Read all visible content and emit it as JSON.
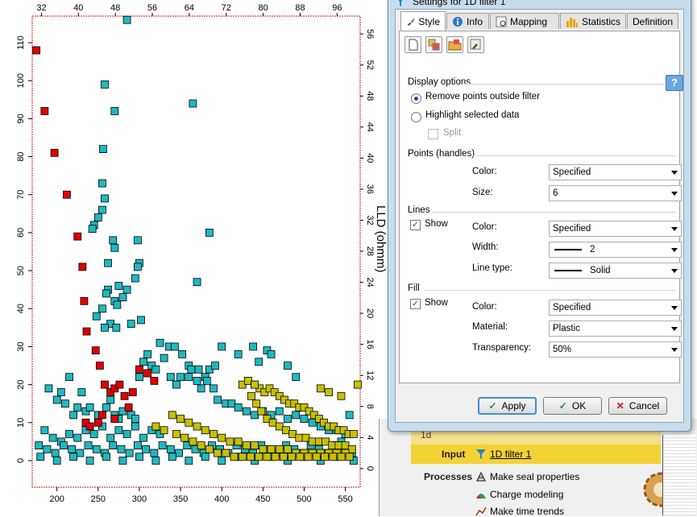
{
  "chart_data": {
    "type": "scatter",
    "title": "",
    "x_axis_bottom": {
      "ticks": [
        "200",
        "250",
        "300",
        "350",
        "400",
        "450",
        "500",
        "550"
      ],
      "range": [
        170,
        568
      ]
    },
    "x_axis_top": {
      "ticks": [
        "32",
        "40",
        "48",
        "56",
        "64",
        "72",
        "80",
        "88",
        "96"
      ],
      "range": [
        30,
        101
      ]
    },
    "y_axis_left": {
      "ticks": [
        "0",
        "10",
        "20",
        "30",
        "40",
        "50",
        "60",
        "70",
        "80",
        "90",
        "100",
        "110"
      ],
      "range": [
        -7,
        117
      ]
    },
    "y_axis_right": {
      "ticks": [
        "0",
        "4",
        "8",
        "12",
        "16",
        "20",
        "24",
        "28",
        "32",
        "36",
        "40",
        "44",
        "48",
        "52",
        "56"
      ],
      "range": [
        -2.4,
        58.3
      ],
      "title": "LLD (ohmm)"
    },
    "grid": false,
    "series": [
      {
        "color": "#e00000",
        "points": [
          [
            175,
            108
          ],
          [
            185,
            92
          ],
          [
            197,
            81
          ],
          [
            212,
            70
          ],
          [
            225,
            59
          ],
          [
            231,
            51
          ],
          [
            233,
            42
          ],
          [
            236,
            34
          ],
          [
            247,
            29
          ],
          [
            252,
            25
          ],
          [
            258,
            20
          ],
          [
            265,
            18
          ],
          [
            270,
            19
          ],
          [
            276,
            20
          ],
          [
            282,
            17
          ],
          [
            287,
            14
          ],
          [
            292,
            18
          ],
          [
            300,
            24
          ],
          [
            310,
            23
          ],
          [
            318,
            21
          ],
          [
            250,
            10
          ],
          [
            255,
            12
          ],
          [
            235,
            10
          ],
          [
            240,
            9
          ],
          [
            270,
            11
          ]
        ]
      },
      {
        "color": "#20b8c0",
        "points": [
          [
            258,
            99
          ],
          [
            270,
            92
          ],
          [
            285,
            116
          ],
          [
            365,
            94
          ],
          [
            256,
            82
          ],
          [
            255,
            73
          ],
          [
            258,
            69
          ],
          [
            255,
            66
          ],
          [
            250,
            64
          ],
          [
            245,
            62
          ],
          [
            243,
            61
          ],
          [
            268,
            58
          ],
          [
            270,
            56
          ],
          [
            262,
            52
          ],
          [
            298,
            58
          ],
          [
            385,
            60
          ],
          [
            300,
            52
          ],
          [
            298,
            51
          ],
          [
            295,
            48
          ],
          [
            262,
            45
          ],
          [
            275,
            46
          ],
          [
            285,
            45
          ],
          [
            260,
            44
          ],
          [
            270,
            42
          ],
          [
            273,
            41
          ],
          [
            280,
            43
          ],
          [
            255,
            40
          ],
          [
            248,
            38
          ],
          [
            265,
            36
          ],
          [
            258,
            35
          ],
          [
            272,
            35
          ],
          [
            290,
            36
          ],
          [
            302,
            37
          ],
          [
            370,
            47
          ],
          [
            330,
            27
          ],
          [
            310,
            28
          ],
          [
            325,
            31
          ],
          [
            336,
            30
          ],
          [
            343,
            30
          ],
          [
            352,
            28
          ],
          [
            360,
            25
          ],
          [
            363,
            24
          ],
          [
            372,
            24
          ],
          [
            380,
            22
          ],
          [
            385,
            24
          ],
          [
            392,
            25
          ],
          [
            400,
            30
          ],
          [
            420,
            28
          ],
          [
            438,
            30
          ],
          [
            445,
            26
          ],
          [
            455,
            29
          ],
          [
            460,
            28
          ],
          [
            480,
            25
          ],
          [
            490,
            22
          ],
          [
            300,
            22
          ],
          [
            305,
            26
          ],
          [
            315,
            25
          ],
          [
            320,
            24
          ],
          [
            338,
            22
          ],
          [
            345,
            20
          ],
          [
            350,
            22
          ],
          [
            360,
            22
          ],
          [
            370,
            21
          ],
          [
            375,
            19
          ],
          [
            382,
            21
          ],
          [
            390,
            19
          ],
          [
            395,
            16
          ],
          [
            405,
            15
          ],
          [
            412,
            15
          ],
          [
            420,
            14
          ],
          [
            430,
            13
          ],
          [
            440,
            12
          ],
          [
            450,
            13
          ],
          [
            460,
            12
          ],
          [
            470,
            13
          ],
          [
            480,
            11
          ],
          [
            490,
            12
          ],
          [
            500,
            11
          ],
          [
            510,
            10
          ],
          [
            520,
            9
          ],
          [
            530,
            8
          ],
          [
            540,
            8
          ],
          [
            550,
            7
          ],
          [
            555,
            12
          ],
          [
            545,
            5
          ],
          [
            190,
            19
          ],
          [
            200,
            16
          ],
          [
            205,
            18
          ],
          [
            210,
            15
          ],
          [
            215,
            22
          ],
          [
            220,
            12
          ],
          [
            225,
            14
          ],
          [
            230,
            18
          ],
          [
            235,
            13
          ],
          [
            240,
            14
          ],
          [
            250,
            12
          ],
          [
            260,
            14
          ],
          [
            265,
            16
          ],
          [
            270,
            12
          ],
          [
            275,
            11
          ],
          [
            280,
            13
          ],
          [
            290,
            12
          ],
          [
            295,
            11
          ],
          [
            185,
            8
          ],
          [
            195,
            6
          ],
          [
            205,
            5
          ],
          [
            215,
            7
          ],
          [
            225,
            6
          ],
          [
            235,
            8
          ],
          [
            245,
            7
          ],
          [
            255,
            9
          ],
          [
            265,
            6
          ],
          [
            275,
            8
          ],
          [
            285,
            7
          ],
          [
            295,
            9
          ],
          [
            305,
            6
          ],
          [
            315,
            8
          ],
          [
            325,
            7
          ],
          [
            178,
            4
          ],
          [
            188,
            3
          ],
          [
            198,
            2
          ],
          [
            208,
            4
          ],
          [
            218,
            3
          ],
          [
            228,
            2
          ],
          [
            238,
            4
          ],
          [
            248,
            3
          ],
          [
            258,
            2
          ],
          [
            268,
            4
          ],
          [
            278,
            3
          ],
          [
            288,
            2
          ],
          [
            298,
            4
          ],
          [
            308,
            3
          ],
          [
            318,
            2
          ],
          [
            328,
            4
          ],
          [
            338,
            3
          ],
          [
            348,
            2
          ],
          [
            358,
            4
          ],
          [
            368,
            3
          ],
          [
            378,
            2
          ],
          [
            388,
            4
          ],
          [
            398,
            3
          ],
          [
            408,
            2
          ],
          [
            418,
            4
          ],
          [
            428,
            3
          ],
          [
            438,
            2
          ],
          [
            448,
            4
          ],
          [
            458,
            3
          ],
          [
            468,
            2
          ],
          [
            478,
            4
          ],
          [
            488,
            3
          ],
          [
            498,
            2
          ],
          [
            508,
            4
          ],
          [
            518,
            3
          ],
          [
            528,
            2
          ],
          [
            538,
            4
          ],
          [
            548,
            3
          ],
          [
            558,
            2
          ],
          [
            180,
            1
          ],
          [
            200,
            0
          ],
          [
            220,
            1
          ],
          [
            240,
            0
          ],
          [
            260,
            1
          ],
          [
            280,
            0
          ],
          [
            300,
            1
          ],
          [
            320,
            0
          ],
          [
            340,
            1
          ],
          [
            360,
            0
          ],
          [
            380,
            1
          ],
          [
            400,
            0
          ],
          [
            420,
            1
          ],
          [
            440,
            0
          ],
          [
            460,
            1
          ],
          [
            480,
            0
          ],
          [
            500,
            1
          ],
          [
            520,
            0
          ],
          [
            540,
            1
          ],
          [
            560,
            0
          ]
        ]
      },
      {
        "color": "#c8c000",
        "points": [
          [
            425,
            20
          ],
          [
            432,
            21
          ],
          [
            440,
            20
          ],
          [
            446,
            19
          ],
          [
            452,
            18
          ],
          [
            458,
            19
          ],
          [
            464,
            18
          ],
          [
            470,
            17
          ],
          [
            476,
            16
          ],
          [
            482,
            15
          ],
          [
            488,
            15
          ],
          [
            494,
            14
          ],
          [
            500,
            14
          ],
          [
            506,
            13
          ],
          [
            512,
            12
          ],
          [
            518,
            11
          ],
          [
            524,
            10
          ],
          [
            530,
            9
          ],
          [
            536,
            9
          ],
          [
            542,
            8
          ],
          [
            548,
            8
          ],
          [
            554,
            7
          ],
          [
            560,
            7
          ],
          [
            436,
            17
          ],
          [
            442,
            15
          ],
          [
            448,
            13
          ],
          [
            455,
            11
          ],
          [
            462,
            10
          ],
          [
            470,
            9
          ],
          [
            478,
            8
          ],
          [
            486,
            7
          ],
          [
            494,
            6
          ],
          [
            502,
            6
          ],
          [
            510,
            5
          ],
          [
            518,
            5
          ],
          [
            526,
            5
          ],
          [
            534,
            4
          ],
          [
            542,
            4
          ],
          [
            550,
            4
          ],
          [
            558,
            3
          ],
          [
            340,
            12
          ],
          [
            350,
            11
          ],
          [
            360,
            10
          ],
          [
            370,
            9
          ],
          [
            380,
            8
          ],
          [
            390,
            7
          ],
          [
            400,
            6
          ],
          [
            410,
            5
          ],
          [
            420,
            5
          ],
          [
            430,
            4
          ],
          [
            440,
            4
          ],
          [
            450,
            3
          ],
          [
            460,
            3
          ],
          [
            470,
            3
          ],
          [
            480,
            3
          ],
          [
            490,
            2
          ],
          [
            500,
            2
          ],
          [
            510,
            2
          ],
          [
            520,
            2
          ],
          [
            530,
            2
          ],
          [
            540,
            2
          ],
          [
            550,
            2
          ],
          [
            320,
            9
          ],
          [
            330,
            8
          ],
          [
            345,
            7
          ],
          [
            355,
            6
          ],
          [
            365,
            5
          ],
          [
            375,
            4
          ],
          [
            385,
            3
          ],
          [
            395,
            2
          ],
          [
            405,
            2
          ],
          [
            415,
            1
          ],
          [
            425,
            1
          ],
          [
            435,
            1
          ],
          [
            445,
            1
          ],
          [
            455,
            1
          ],
          [
            465,
            1
          ],
          [
            475,
            1
          ],
          [
            485,
            1
          ],
          [
            495,
            1
          ],
          [
            505,
            1
          ],
          [
            515,
            1
          ],
          [
            525,
            1
          ],
          [
            535,
            1
          ],
          [
            545,
            1
          ],
          [
            555,
            1
          ],
          [
            440,
            20
          ],
          [
            520,
            19
          ],
          [
            530,
            18
          ],
          [
            545,
            17
          ],
          [
            565,
            20
          ]
        ]
      }
    ]
  },
  "dialog": {
    "title": "Settings for 1D filter 1",
    "tabs": [
      "Style",
      "Info",
      "Mapping",
      "Statistics",
      "Definition"
    ],
    "display_options": "Display options",
    "remove_points": "Remove points outside filter",
    "highlight": "Highlight selected data",
    "split": "Split",
    "points_section": "Points (handles)",
    "points_color_label": "Color:",
    "points_color": "Specified",
    "points_size_label": "Size:",
    "points_size": "6",
    "lines_section": "Lines",
    "lines_show": "Show",
    "lines_color_label": "Color:",
    "lines_color": "Specified",
    "lines_width_label": "Width:",
    "lines_width": "2",
    "lines_type_label": "Line type:",
    "lines_type": "Solid",
    "fill_section": "Fill",
    "fill_show": "Show",
    "fill_color_label": "Color:",
    "fill_color": "Specified",
    "fill_material_label": "Material:",
    "fill_material": "Plastic",
    "fill_transparency_label": "Transparency:",
    "fill_transparency": "50%",
    "help": "?",
    "apply": "Apply",
    "ok": "OK",
    "cancel": "Cancel"
  },
  "background_panel": {
    "id_text": "1d",
    "input_label": "Input",
    "input_value": "1D filter 1",
    "processes_label": "Processes",
    "processes": [
      "Make seal properties",
      "Charge modeling",
      "Make time trends"
    ]
  },
  "colors": {
    "accent": "#3a8fd8",
    "input_highlight": "#f3d236",
    "red_series": "#e00000",
    "cyan_series": "#20b8c0",
    "yellow_series": "#c8c000"
  }
}
